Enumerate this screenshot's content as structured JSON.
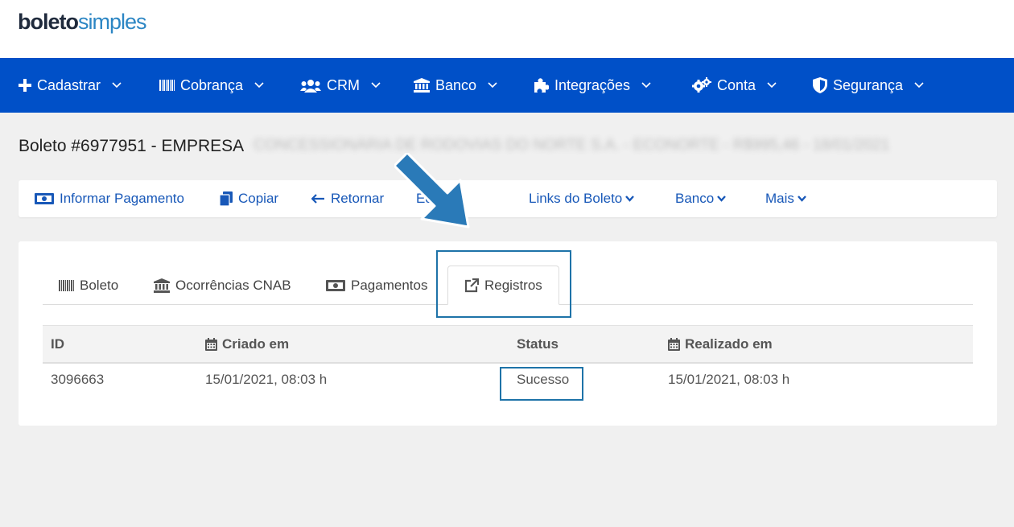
{
  "logo": {
    "part1": "boleto",
    "part2": "simples"
  },
  "nav": [
    {
      "label": "Cadastrar",
      "icon": "plus-icon"
    },
    {
      "label": "Cobrança",
      "icon": "barcode-icon"
    },
    {
      "label": "CRM",
      "icon": "users-icon"
    },
    {
      "label": "Banco",
      "icon": "bank-icon"
    },
    {
      "label": "Integrações",
      "icon": "puzzle-icon"
    },
    {
      "label": "Conta",
      "icon": "gears-icon"
    },
    {
      "label": "Segurança",
      "icon": "shield-icon"
    }
  ],
  "page": {
    "title": "Boleto #6977951 - EMPRESA",
    "title_blurred": "CONCESSIONÁRIA DE RODOVIAS DO NORTE S.A. - ECONORTE - R$995,46 - 18/01/2021"
  },
  "toolbar": [
    {
      "label": "Informar Pagamento",
      "icon": "money-icon"
    },
    {
      "label": "Copiar",
      "icon": "copy-icon"
    },
    {
      "label": "Retornar",
      "icon": "arrow-left-icon"
    },
    {
      "label": "Editor",
      "icon": ""
    },
    {
      "label": "Links do Boleto",
      "icon": ""
    },
    {
      "label": "Banco",
      "icon": ""
    },
    {
      "label": "Mais",
      "icon": ""
    }
  ],
  "tabs": [
    {
      "label": "Boleto",
      "icon": "barcode-icon"
    },
    {
      "label": "Ocorrências CNAB",
      "icon": "bank-icon"
    },
    {
      "label": "Pagamentos",
      "icon": "money-icon"
    },
    {
      "label": "Registros",
      "icon": "external-link-icon",
      "active": true
    }
  ],
  "table": {
    "headers": [
      "ID",
      "Criado em",
      "Status",
      "Realizado em"
    ],
    "rows": [
      [
        "3096663",
        "15/01/2021, 08:03 h",
        "Sucesso",
        "15/01/2021, 08:03 h"
      ]
    ]
  },
  "colors": {
    "nav_bg": "#0050c8",
    "link": "#1858b8",
    "highlight": "#1e73a8",
    "arrow": "#2a7ab8"
  }
}
